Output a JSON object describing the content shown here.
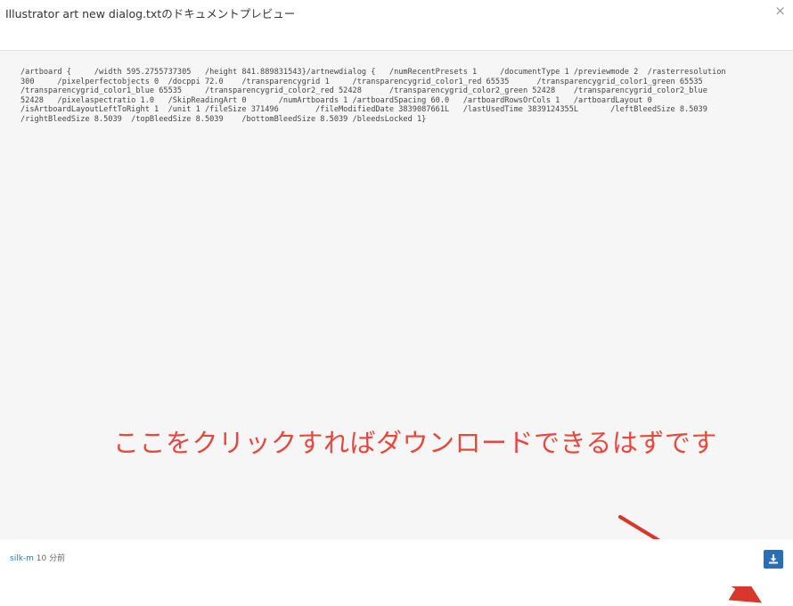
{
  "header": {
    "title": "Illustrator art new dialog.txtのドキュメントプレビュー",
    "close_icon": "close-icon",
    "close_symbol": "×"
  },
  "preview": {
    "content": "/artboard {     /width 595.2755737305   /height 841.889831543}/artnewdialog {   /numRecentPresets 1     /documentType 1 /previewmode 2  /rasterresolution\n300     /pixelperfectobjects 0  /docppi 72.0    /transparencygrid 1     /transparencygrid_color1_red 65535      /transparencygrid_color1_green 65535\n/transparencygrid_color1_blue 65535     /transparencygrid_color2_red 52428      /transparencygrid_color2_green 52428    /transparencygrid_color2_blue\n52428   /pixelaspectratio 1.0   /SkipReadingArt 0       /numArtboards 1 /artboardSpacing 60.0   /artboardRowsOrCols 1   /artboardLayout 0\n/isArtboardLayoutLeftToRight 1  /unit 1 /fileSize 371496        /fileModifiedDate 3839087661L   /lastUsedTime 3839124355L       /leftBleedSize 8.5039\n/rightBleedSize 8.5039  /topBleedSize 8.5039    /bottomBleedSize 8.5039 /bleedsLocked 1}"
  },
  "annotation": {
    "text": "ここをクリックすればダウンロードできるはずです",
    "color": "#e8473f"
  },
  "footer": {
    "author": "silk-m",
    "time": " 10 分前",
    "download_icon": "download-icon"
  },
  "colors": {
    "button": "#2a6fb5",
    "arrow": "#d8372b",
    "link": "#2a7ab8"
  }
}
